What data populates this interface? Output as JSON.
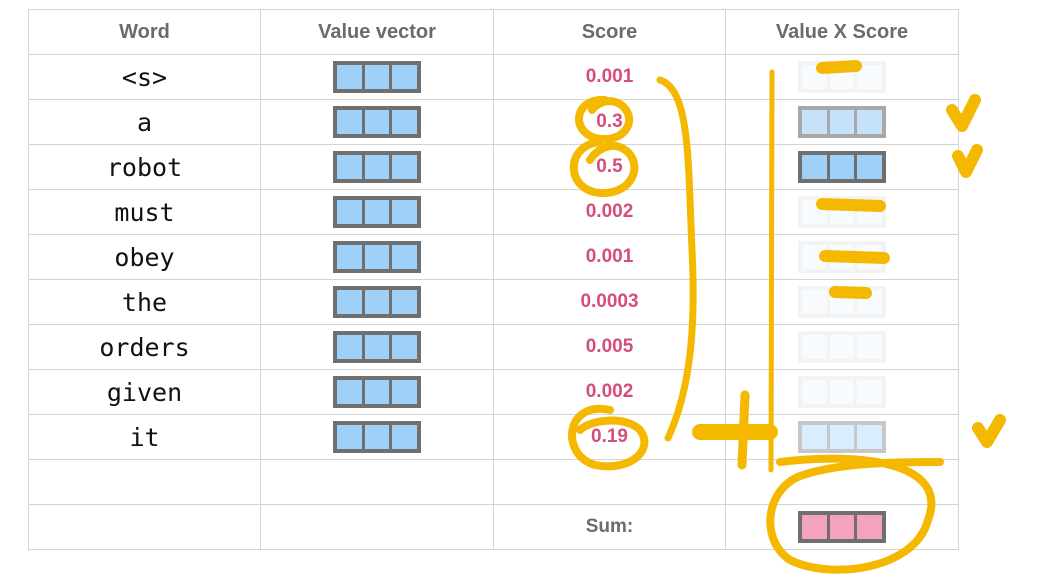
{
  "headers": {
    "word": "Word",
    "value_vector": "Value vector",
    "score": "Score",
    "value_x_score": "Value X Score"
  },
  "rows": [
    {
      "word": "<s>",
      "score": "0.001",
      "weighted_level": 0.001
    },
    {
      "word": "a",
      "score": "0.3",
      "weighted_level": 0.3
    },
    {
      "word": "robot",
      "score": "0.5",
      "weighted_level": 0.5
    },
    {
      "word": "must",
      "score": "0.002",
      "weighted_level": 0.002
    },
    {
      "word": "obey",
      "score": "0.001",
      "weighted_level": 0.001
    },
    {
      "word": "the",
      "score": "0.0003",
      "weighted_level": 0.0003
    },
    {
      "word": "orders",
      "score": "0.005",
      "weighted_level": 0.005
    },
    {
      "word": "given",
      "score": "0.002",
      "weighted_level": 0.002
    },
    {
      "word": "it",
      "score": "0.19",
      "weighted_level": 0.19
    }
  ],
  "sum_label": "Sum:",
  "colors": {
    "value_cell": "#9fd0f8",
    "value_border": "#6f6f6f",
    "sum_cell": "#f3a3bd",
    "score_text": "#d64d7a",
    "annotation": "#f5b800",
    "grid": "#d4d4d4"
  },
  "annotations": {
    "circled_scores": [
      "0.3",
      "0.5",
      "0.19"
    ],
    "checkmarks": [
      "a",
      "robot",
      "it"
    ],
    "dashed_rows": [
      "<s>",
      "must",
      "obey",
      "the"
    ]
  }
}
